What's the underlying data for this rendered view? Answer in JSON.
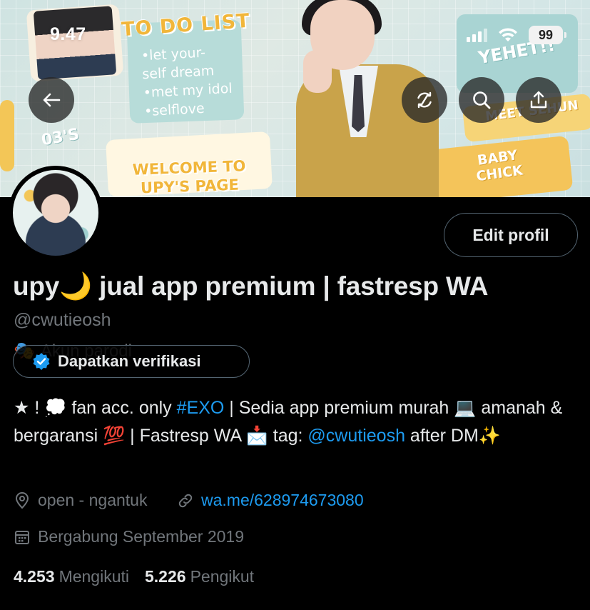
{
  "status_bar": {
    "time": "9.47",
    "battery": "99"
  },
  "banner": {
    "todo_title": "TO DO LIST",
    "todo_items": [
      "•let your-",
      " self dream",
      "•met my idol",
      "•selflove"
    ],
    "welcome": [
      "WELCOME TO",
      "UPY'S PAGE"
    ],
    "baby": [
      "BABY",
      "CHICK"
    ],
    "meet": "MEET SEHUN",
    "yehet": "YEHET!!",
    "o3s": "03'S"
  },
  "profile": {
    "display_name": "upy🌙 jual app premium | fastresp WA",
    "handle": "@cwutieosh",
    "parody_label": "Akun parodi",
    "edit_button": "Edit profil",
    "verify_button": "Dapatkan verifikasi",
    "bio": {
      "seg1": "★ ! 💭 fan acc. only ",
      "hashtag": "#EXO",
      "seg2": " | Sedia app premium murah 💻 amanah & bergaransi 💯  | Fastresp WA 📩 tag: ",
      "mention": "@cwutieosh",
      "seg3": " after DM✨"
    },
    "location": "open - ngantuk",
    "website": "wa.me/628974673080",
    "joined": "Bergabung September 2019",
    "following_count": "4.253",
    "following_label": "Mengikuti",
    "followers_count": "5.226",
    "followers_label": "Pengikut"
  },
  "colors": {
    "link": "#1d9bf0",
    "muted": "#71767b",
    "text": "#e7e9ea",
    "background": "#000000"
  },
  "icons": [
    "back-arrow-icon",
    "refresh-icon",
    "search-icon",
    "share-icon",
    "location-pin-icon",
    "link-icon",
    "calendar-icon",
    "verified-badge-icon",
    "parody-mask-icon"
  ]
}
